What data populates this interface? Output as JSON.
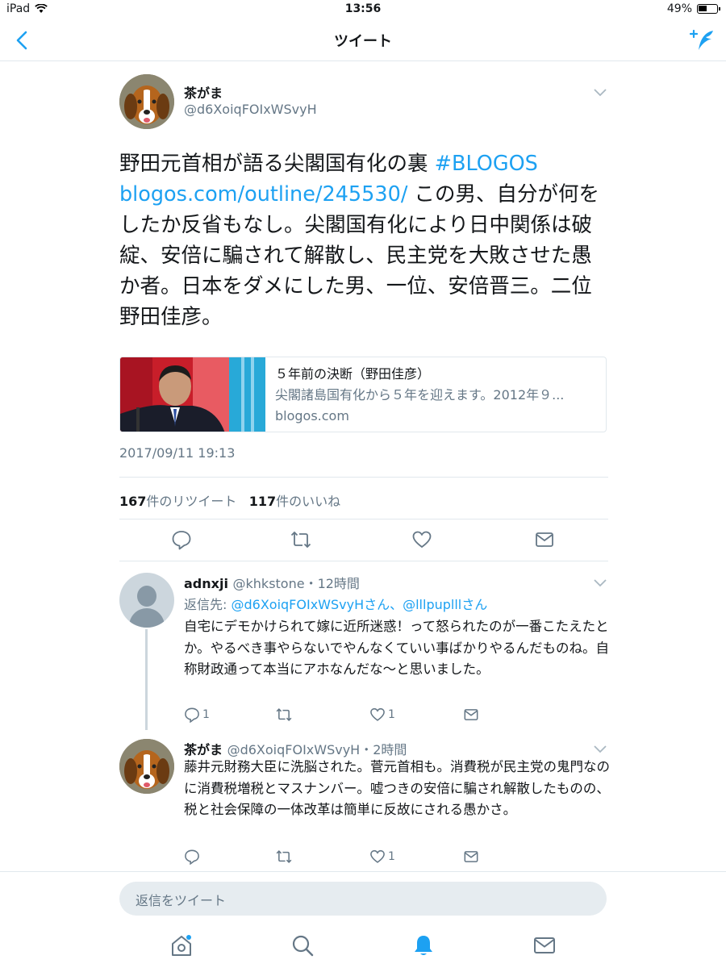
{
  "status": {
    "device": "iPad",
    "time": "13:56",
    "battery": "49%",
    "battery_level": 0.49
  },
  "nav": {
    "title": "ツイート"
  },
  "tweet": {
    "name": "茶がま",
    "handle": "@d6XoiqFOIxWSvyH",
    "text_1": "野田元首相が語る尖閣国有化の裏 ",
    "hashtag": "#BLOGOS",
    "link": "blogos.com/outline/245530/",
    "text_2": " この男、自分が何をしたか反省もなし。尖閣国有化により日中関係は破綻、安倍に騙されて解散し、民主党を大敗させた愚か者。日本をダメにした男、一位、安倍晋三。二位　野田佳彦。",
    "card": {
      "title": "５年前の決断（野田佳彦）",
      "description": "尖閣諸島国有化から５年を迎えます。2012年９...",
      "domain": "blogos.com"
    },
    "timestamp": "2017/09/11 19:13",
    "retweets": "167",
    "retweets_label": "件のリツイート",
    "likes": "117",
    "likes_label": "件のいいね"
  },
  "replies": [
    {
      "name": "adnxji",
      "meta": "@khkstone・12時間",
      "reply_to_prefix": "返信先: ",
      "reply_to": "@d6XoiqFOIxWSvyHさん、@lllpuplllさん",
      "text": "自宅にデモかけられて嫁に近所迷惑！って怒られたのが一番こたえたとか。やるべき事やらないでやんなくていい事ばかりやるんだものね。自称財政通って本当にアホなんだな〜と思いました。",
      "reply_count": "1",
      "like_count": "1"
    },
    {
      "name": "茶がま",
      "meta": "@d6XoiqFOIxWSvyH・2時間",
      "text": "藤井元財務大臣に洗脳された。菅元首相も。消費税が民主党の鬼門なのに消費税増税とマスナンバー。嘘つきの安倍に騙され解散したものの、税と社会保障の一体改革は簡単に反故にされる愚かさ。",
      "reply_count": "",
      "like_count": "1"
    }
  ],
  "composer": {
    "placeholder": "返信をツイート"
  },
  "colors": {
    "accent": "#1da1f2",
    "muted": "#657786",
    "border": "#e1e8ed"
  }
}
